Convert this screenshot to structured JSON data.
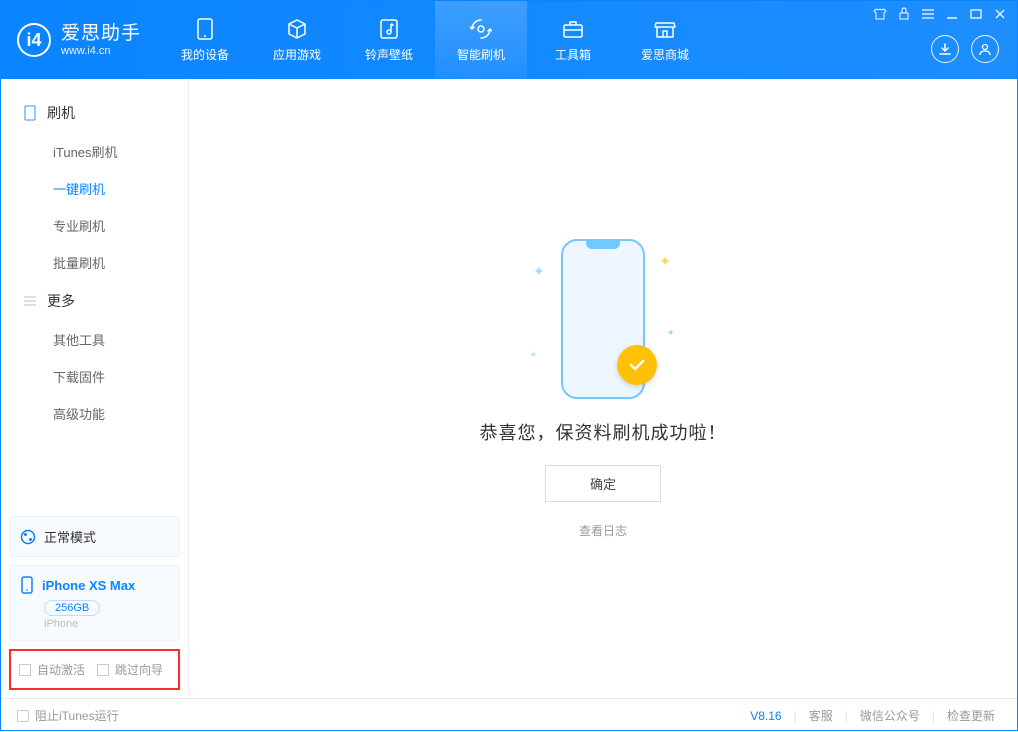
{
  "brand": {
    "name": "爱思助手",
    "url": "www.i4.cn"
  },
  "nav": {
    "items": [
      {
        "label": "我的设备"
      },
      {
        "label": "应用游戏"
      },
      {
        "label": "铃声壁纸"
      },
      {
        "label": "智能刷机"
      },
      {
        "label": "工具箱"
      },
      {
        "label": "爱思商城"
      }
    ]
  },
  "sidebar": {
    "section1": "刷机",
    "items1": [
      "iTunes刷机",
      "一键刷机",
      "专业刷机",
      "批量刷机"
    ],
    "section2": "更多",
    "items2": [
      "其他工具",
      "下载固件",
      "高级功能"
    ]
  },
  "mode": {
    "label": "正常模式"
  },
  "device": {
    "name": "iPhone XS Max",
    "capacity": "256GB",
    "type": "iPhone"
  },
  "options": {
    "auto_activate": "自动激活",
    "skip_guide": "跳过向导"
  },
  "main": {
    "message": "恭喜您，保资料刷机成功啦！",
    "ok": "确定",
    "view_log": "查看日志"
  },
  "footer": {
    "block_itunes": "阻止iTunes运行",
    "version": "V8.16",
    "links": [
      "客服",
      "微信公众号",
      "检查更新"
    ]
  }
}
